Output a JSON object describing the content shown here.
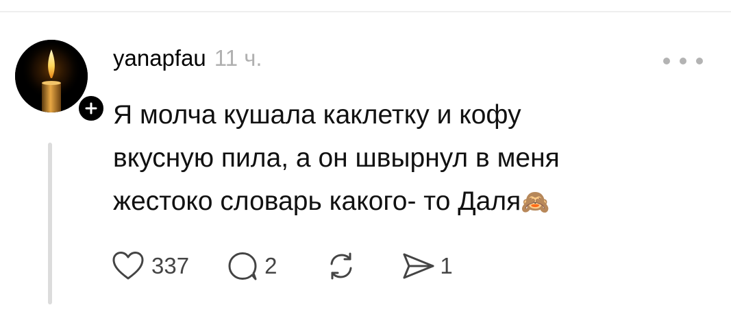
{
  "post": {
    "username": "yanapfau",
    "timestamp": "11 ч.",
    "text_lines": [
      "Я молча кушала каклетку и кофу",
      "вкусную пила, а он швырнул в меня",
      "жестоко словарь какого- то Даля"
    ],
    "emoji": "🙈",
    "emoji_name": "see-no-evil-monkey"
  },
  "actions": {
    "likes": "337",
    "replies": "2",
    "shares": "1"
  },
  "icons": {
    "avatar": "candle-flame",
    "follow": "plus-icon",
    "more": "more-dots-icon",
    "like": "heart-icon",
    "reply": "speech-bubble-icon",
    "repost": "repost-arrows-icon",
    "share": "send-arrow-icon"
  },
  "colors": {
    "text": "#111111",
    "muted": "#b0b0b0",
    "icon": "#444444",
    "thread_line": "#dcdcdc"
  }
}
